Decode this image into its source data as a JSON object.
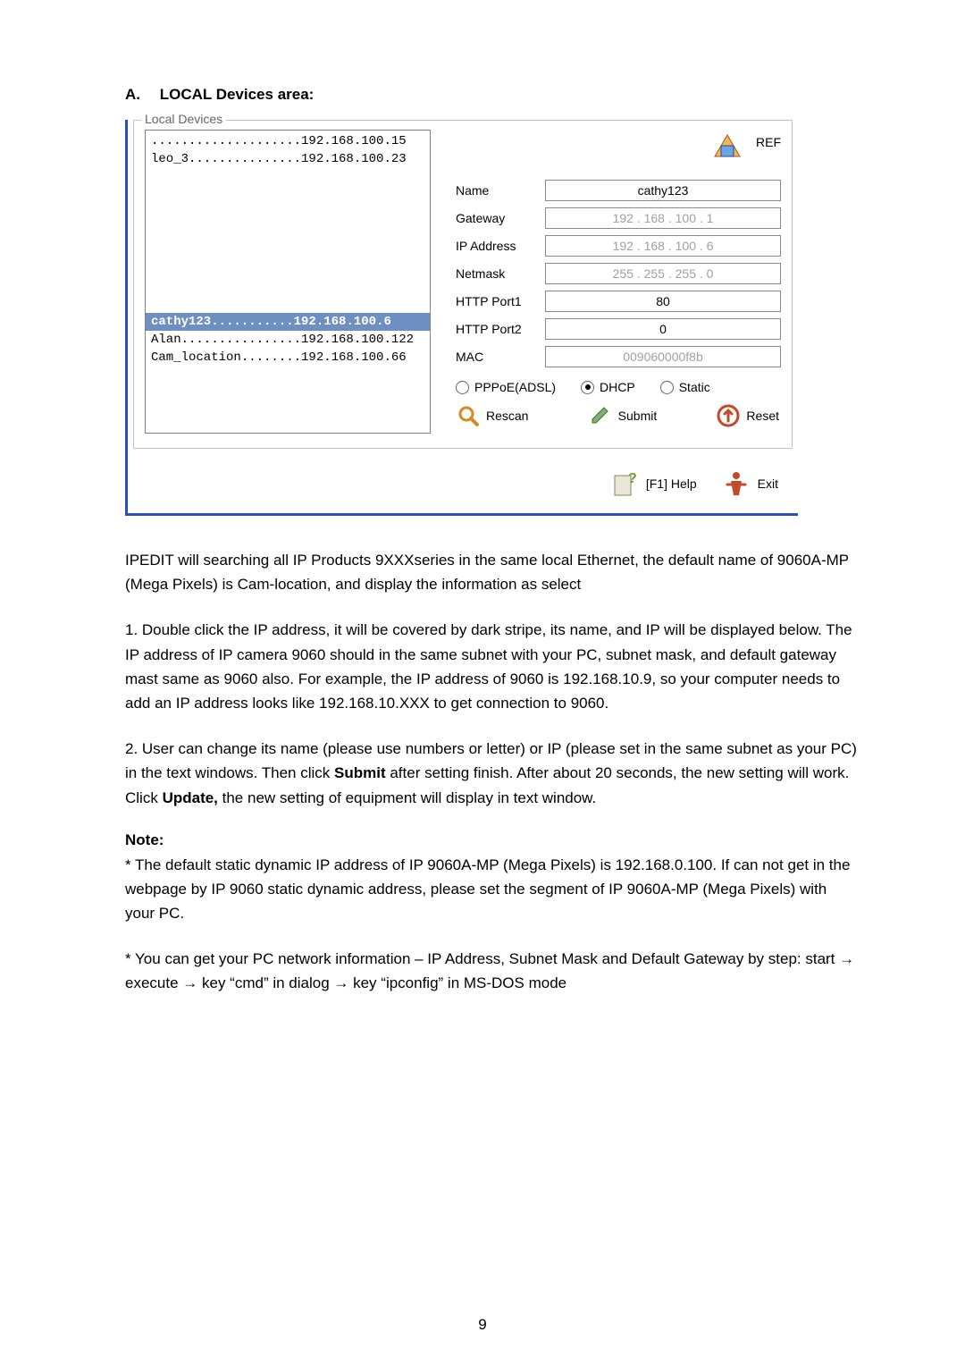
{
  "heading_letter": "A.",
  "heading_text": "LOCAL Devices area:",
  "fieldset_title": "Local Devices",
  "device_rows": [
    "....................192.168.100.15",
    "leo_3...............192.168.100.23"
  ],
  "device_selected": "cathy123...........192.168.100.6",
  "device_rows2": [
    "Alan................192.168.100.122",
    "Cam_location........192.168.100.66"
  ],
  "ref_label": "REF",
  "labels": {
    "name": "Name",
    "gateway": "Gateway",
    "ip": "IP Address",
    "netmask": "Netmask",
    "p1": "HTTP Port1",
    "p2": "HTTP Port2",
    "mac": "MAC"
  },
  "values": {
    "name": "cathy123",
    "gateway": "192 . 168 . 100 .   1",
    "ip": "192 . 168 . 100 .   6",
    "netmask": "255 . 255 . 255 .   0",
    "p1": "80",
    "p2": "0",
    "mac": "009060000f8b"
  },
  "radios": {
    "pppoe": "PPPoE(ADSL)",
    "dhcp": "DHCP",
    "static_opt": "Static"
  },
  "buttons": {
    "rescan": "Rescan",
    "submit": "Submit",
    "reset": "Reset",
    "help": "[F1] Help",
    "exit": "Exit"
  },
  "body": {
    "p1": "IPEDIT will searching all IP Products 9XXXseries in the same local Ethernet, the default name of 9060A-MP (Mega Pixels) is Cam-location, and display the information as select",
    "p2": "1. Double click the IP address, it will be covered by dark stripe, its name, and IP will be displayed below. The IP address of IP camera 9060 should in the same subnet with your PC, subnet mask, and default gateway mast same as 9060 also. For example, the IP address of 9060 is 192.168.10.9, so your computer needs to add an IP address looks like 192.168.10.XXX to get connection to 9060.",
    "p3a": "2. User can change its name (please use numbers or letter) or IP (please set in the same subnet as your PC) in the text windows. Then click ",
    "p3b": "Submit",
    "p3c": " after setting finish. After about 20 seconds, the new setting will work. Click ",
    "p3d": "Update,",
    "p3e": " the new setting of equipment will display in text window.",
    "note": "Note:",
    "p4": "* The default static dynamic IP address of IP 9060A-MP (Mega Pixels) is 192.168.0.100. If can not get in the webpage by IP 9060 static dynamic address, please set the segment of IP 9060A-MP (Mega Pixels) with your PC.",
    "p5": "* You can get your PC network information – IP Address, Subnet Mask and Default Gateway by step: start → execute → key “cmd” in dialog →   key   “ipconfig” in MS-DOS mode"
  },
  "page_number": "9"
}
